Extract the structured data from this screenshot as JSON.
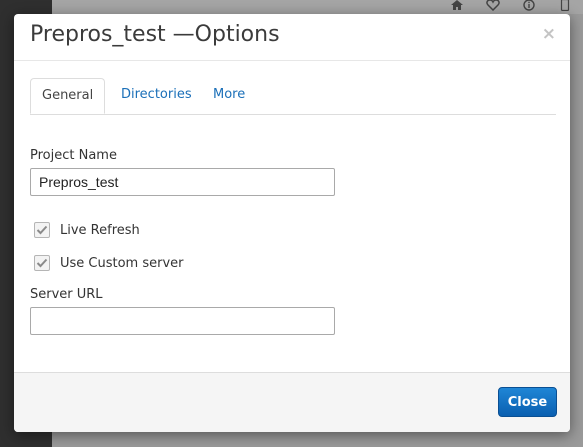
{
  "background": {
    "icons": [
      "home-icon",
      "heart-icon",
      "info-icon",
      "phone-icon"
    ]
  },
  "modal": {
    "title": "Prepros_test —Options",
    "close_glyph": "×"
  },
  "tabs": [
    {
      "label": "General",
      "active": true
    },
    {
      "label": "Directories",
      "active": false
    },
    {
      "label": "More",
      "active": false
    }
  ],
  "form": {
    "project_name_label": "Project Name",
    "project_name_value": "Prepros_test",
    "live_refresh_label": "Live Refresh",
    "live_refresh_checked": true,
    "custom_server_label": "Use Custom server",
    "custom_server_checked": true,
    "server_url_label": "Server URL",
    "server_url_value": ""
  },
  "footer": {
    "close_label": "Close"
  },
  "colors": {
    "accent": "#0d66b8",
    "link": "#1a6fb8",
    "overlay_sidebar": "#2f2f2f"
  }
}
